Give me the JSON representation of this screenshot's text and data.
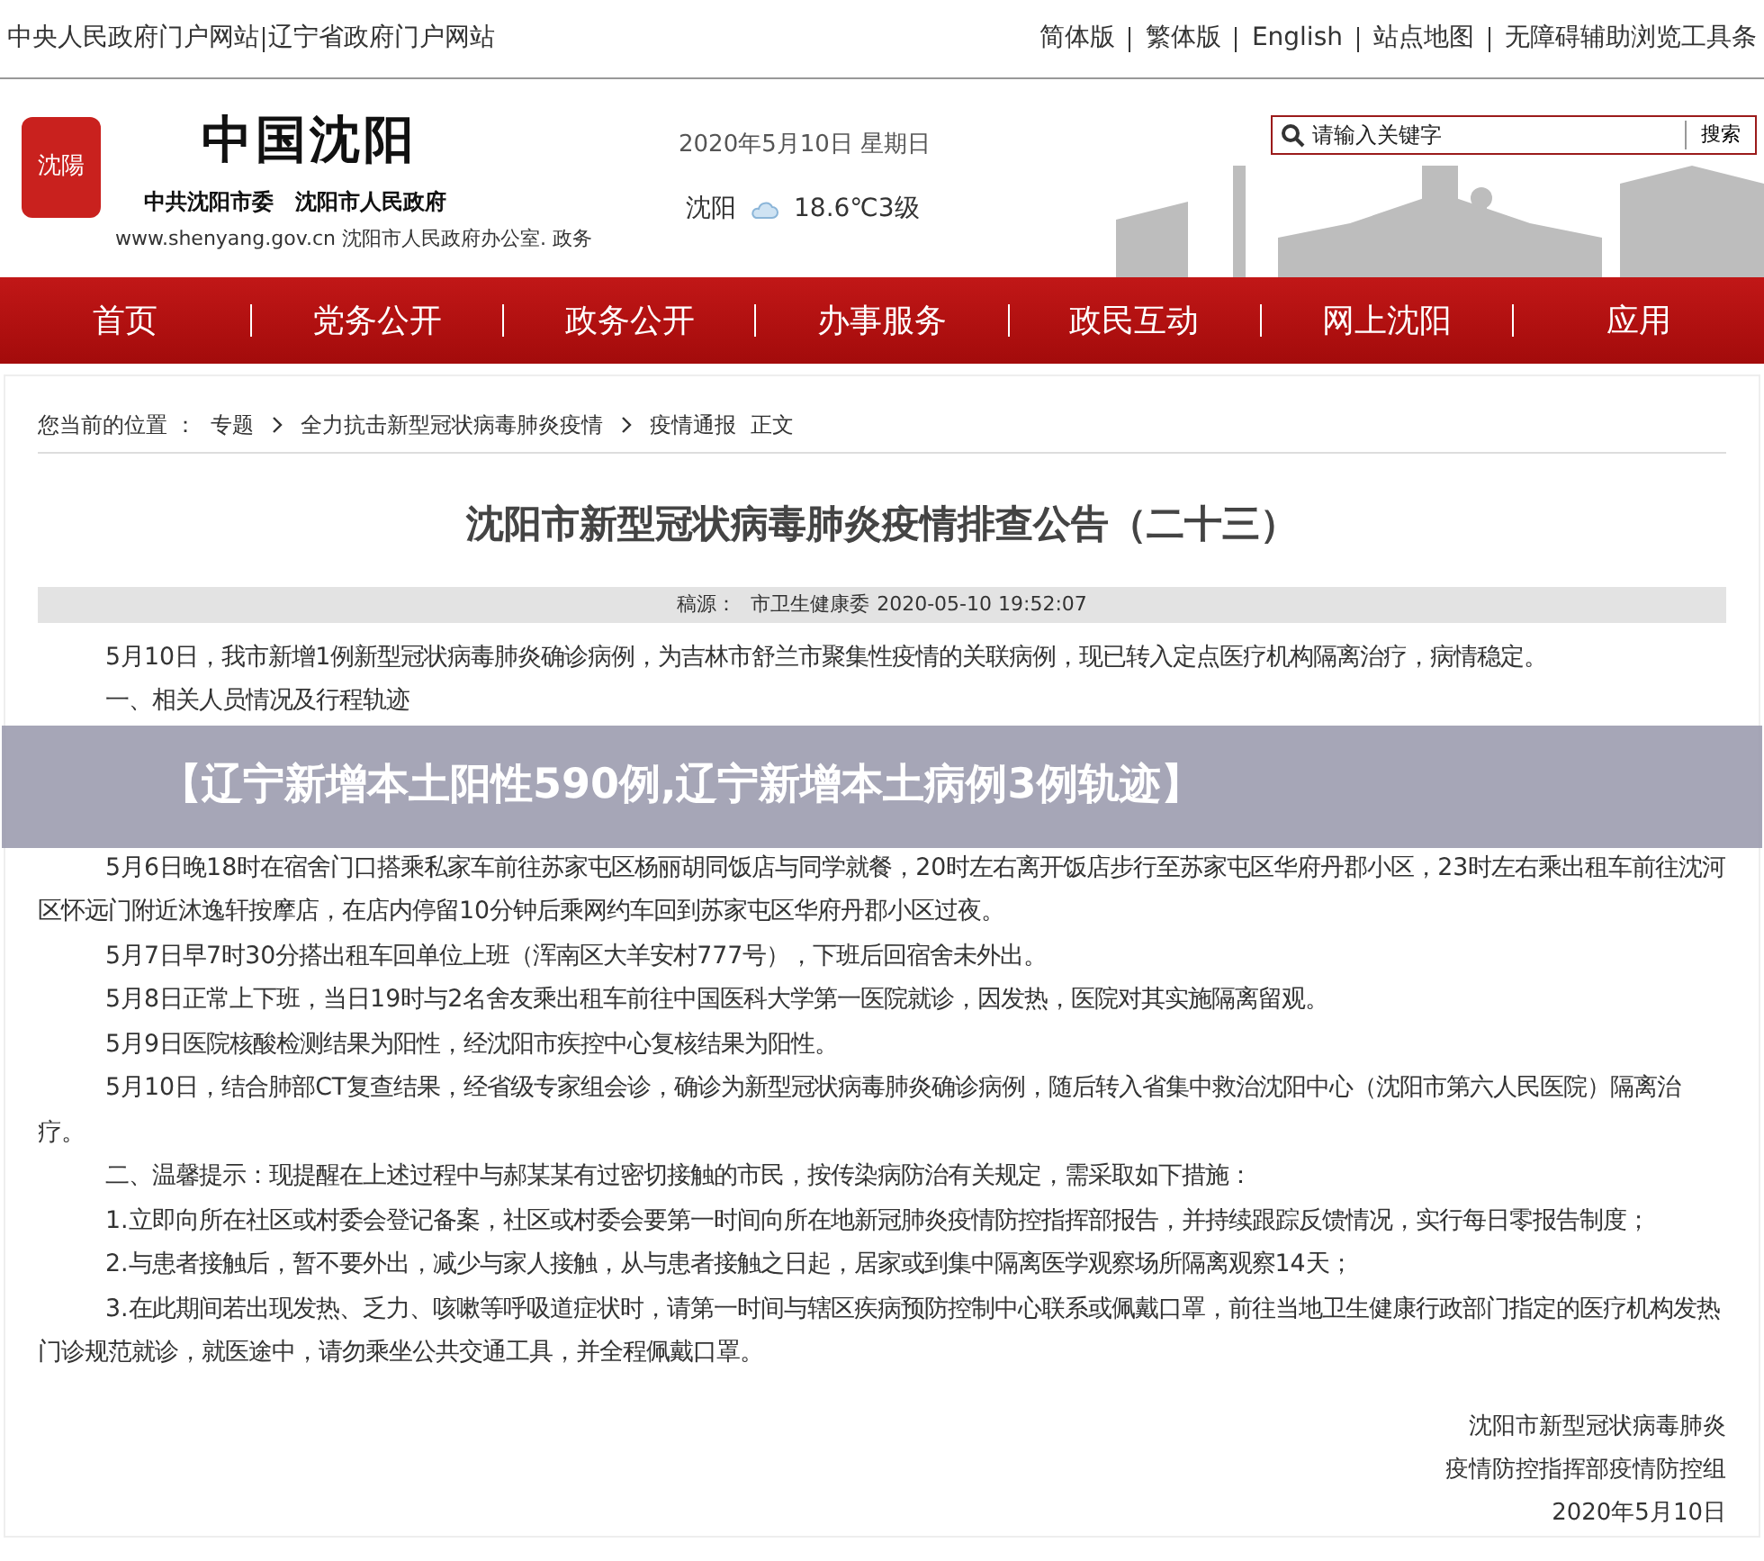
{
  "top_bar": {
    "left": [
      "中央人民政府门户网站",
      "辽宁省政府门户网站"
    ],
    "right": [
      "简体版",
      "繁体版",
      "English",
      "站点地图",
      "无障碍辅助浏览工具条"
    ]
  },
  "header": {
    "logo_seal": "沈陽",
    "logo_title": "中国沈阳",
    "logo_subtitle": "中共沈阳市委　沈阳市人民政府",
    "site_url": "www.shenyang.gov.cn 沈阳市人民政府办公室. 政务",
    "date": "2020年5月10日 星期日",
    "city": "沈阳",
    "weather": "18.6℃3级",
    "search": {
      "placeholder": "请输入关键字",
      "button": "搜索"
    }
  },
  "nav": [
    "首页",
    "党务公开",
    "政务公开",
    "办事服务",
    "政民互动",
    "网上沈阳",
    "应用"
  ],
  "breadcrumb": {
    "label": "您当前的位置 ：",
    "items": [
      "专题",
      "全力抗击新型冠状病毒肺炎疫情",
      "疫情通报",
      "正文"
    ]
  },
  "article": {
    "title": "沈阳市新型冠状病毒肺炎疫情排查公告（二十三）",
    "source_label": "稿源：",
    "source": "市卫生健康委",
    "time": "2020-05-10 19:52:07",
    "paragraphs": [
      {
        "kind": "text",
        "text": "5月10日，我市新增1例新型冠状病毒肺炎确诊病例，为吉林市舒兰市聚集性疫情的关联病例，现已转入定点医疗机构隔离治疗，病情稳定。"
      },
      {
        "kind": "text",
        "text": "一、相关人员情况及行程轨迹"
      },
      {
        "kind": "banner",
        "text": "【辽宁新增本土阳性590例,辽宁新增本土病例3例轨迹】"
      },
      {
        "kind": "text",
        "text": "5月6日晚18时在宿舍门口搭乘私家车前往苏家屯区杨丽胡同饭店与同学就餐，20时左右离开饭店步行至苏家屯区华府丹郡小区，23时左右乘出租车前往沈河区怀远门附近沐逸轩按摩店，在店内停留10分钟后乘网约车回到苏家屯区华府丹郡小区过夜。"
      },
      {
        "kind": "text",
        "text": "5月7日早7时30分搭出租车回单位上班（浑南区大羊安村777号），下班后回宿舍未外出。"
      },
      {
        "kind": "text",
        "text": "5月8日正常上下班，当日19时与2名舍友乘出租车前往中国医科大学第一医院就诊，因发热，医院对其实施隔离留观。"
      },
      {
        "kind": "text",
        "text": "5月9日医院核酸检测结果为阳性，经沈阳市疾控中心复核结果为阳性。"
      },
      {
        "kind": "text",
        "text": "5月10日，结合肺部CT复查结果，经省级专家组会诊，确诊为新型冠状病毒肺炎确诊病例，随后转入省集中救治沈阳中心（沈阳市第六人民医院）隔离治疗。"
      },
      {
        "kind": "text",
        "text": "二、温馨提示：现提醒在上述过程中与郝某某有过密切接触的市民，按传染病防治有关规定，需采取如下措施："
      },
      {
        "kind": "text",
        "text": "1.立即向所在社区或村委会登记备案，社区或村委会要第一时间向所在地新冠肺炎疫情防控指挥部报告，并持续跟踪反馈情况，实行每日零报告制度；"
      },
      {
        "kind": "text",
        "text": "2.与患者接触后，暂不要外出，减少与家人接触，从与患者接触之日起，居家或到集中隔离医学观察场所隔离观察14天；"
      },
      {
        "kind": "text",
        "text": "3.在此期间若出现发热、乏力、咳嗽等呼吸道症状时，请第一时间与辖区疾病预防控制中心联系或佩戴口罩，前往当地卫生健康行政部门指定的医疗机构发热门诊规范就诊，就医途中，请勿乘坐公共交通工具，并全程佩戴口罩。"
      }
    ],
    "signature": [
      "沈阳市新型冠状病毒肺炎",
      "疫情防控指挥部疫情防控组",
      "2020年5月10日"
    ]
  }
}
